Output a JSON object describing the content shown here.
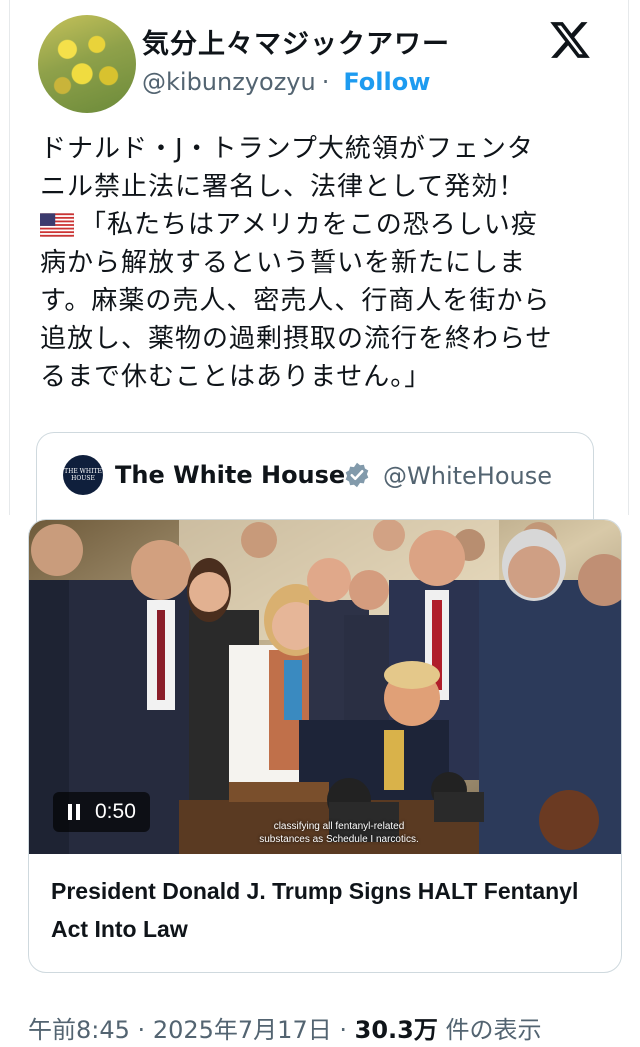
{
  "author": {
    "display_name": "気分上々マジックアワー",
    "handle": "@kibunzyozyu",
    "separator": "·",
    "follow_label": "Follow",
    "avatar_icon": "rapeseed-flower-avatar",
    "logo_icon": "x-logo-icon"
  },
  "tweet": {
    "lines": [
      "ドナルド・J・トランプ大統領がフェンタ",
      "ニル禁止法に署名し、法律として発効！",
      "「私たちはアメリカをこの恐ろしい疫",
      "病から解放するという誓いを新たにしま",
      "す。麻薬の売人、密売人、行商人を街から",
      "追放し、薬物の過剰摂取の流行を終わらせ",
      "るまで休むことはありません。」"
    ],
    "flag_icon": "us-flag-icon"
  },
  "quote": {
    "logo_text": "THE WHITE HOUSE",
    "name": "The White House",
    "handle": "@WhiteHouse",
    "verified_icon": "gray-verified-badge-icon"
  },
  "media": {
    "time": "0:50",
    "caption_line1": "classifying all fentanyl-related",
    "caption_line2": "substances as Schedule I narcotics.",
    "title": "President Donald J. Trump Signs HALT Fentanyl Act Into Law"
  },
  "meta": {
    "time": "午前8:45",
    "sep1": "·",
    "date": "2025年7月17日",
    "sep2": "·",
    "views_count": "30.3万",
    "views_label": "件の表示"
  },
  "colors": {
    "accent": "#1d9bf0",
    "muted": "#536471",
    "text": "#0f1419",
    "border": "#cfd9de"
  }
}
